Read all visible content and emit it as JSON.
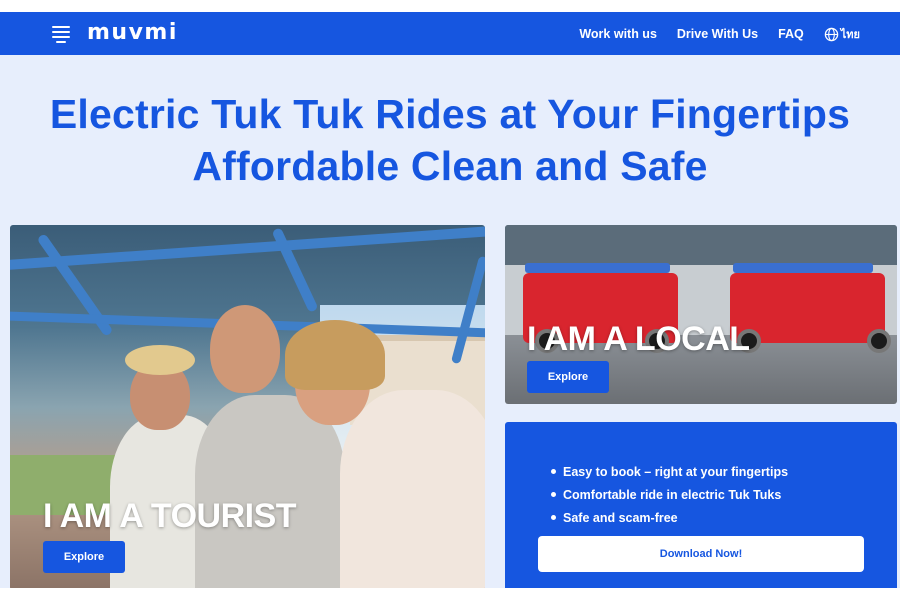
{
  "brand": {
    "logo": "muvmi",
    "accent_color": "#1656e0",
    "background_color": "#e7eefc"
  },
  "nav": {
    "menu_icon": "hamburger-menu-icon",
    "links": [
      "Work with us",
      "Drive With Us",
      "FAQ"
    ],
    "language": {
      "icon": "globe-icon",
      "label": "ไทย"
    }
  },
  "hero": {
    "line1": "Electric Tuk Tuk Rides at Your Fingertips",
    "line2": "Affordable Clean and Safe"
  },
  "tourist_card": {
    "title": "I AM A TOURIST",
    "button": "Explore"
  },
  "local_card": {
    "title": "I AM A LOCAL",
    "button": "Explore"
  },
  "promo": {
    "features": [
      "Easy to book – right at your fingertips",
      "Comfortable ride in electric Tuk Tuks",
      "Safe and scam-free"
    ],
    "button": "Download Now!"
  }
}
